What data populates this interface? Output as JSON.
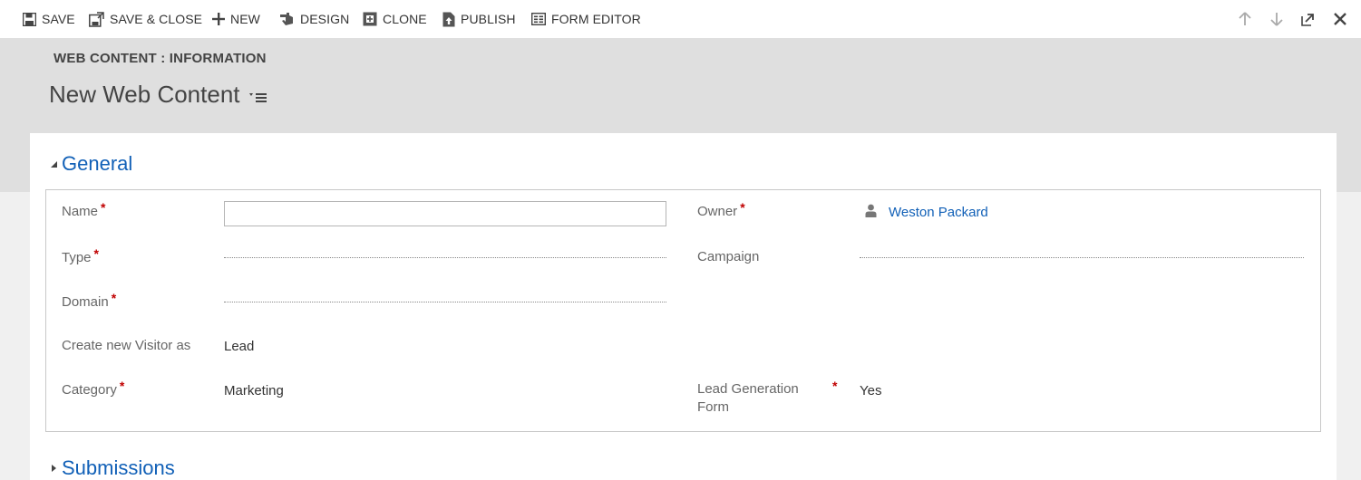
{
  "toolbar": {
    "save": "SAVE",
    "save_close": "SAVE & CLOSE",
    "new": "NEW",
    "design": "DESIGN",
    "clone": "CLONE",
    "publish": "PUBLISH",
    "form_editor": "FORM EDITOR"
  },
  "header": {
    "entity": "WEB CONTENT : INFORMATION",
    "title": "New Web Content"
  },
  "sections": {
    "general": "General",
    "submissions": "Submissions"
  },
  "fields": {
    "name": {
      "label": "Name",
      "value": ""
    },
    "type": {
      "label": "Type",
      "value": ""
    },
    "domain": {
      "label": "Domain",
      "value": ""
    },
    "create_visitor": {
      "label": "Create new Visitor as",
      "value": "Lead"
    },
    "category": {
      "label": "Category",
      "value": "Marketing"
    },
    "owner": {
      "label": "Owner",
      "value": "Weston Packard"
    },
    "campaign": {
      "label": "Campaign",
      "value": ""
    },
    "lead_gen_form": {
      "label_line1": "Lead Generation",
      "label_line2": "Form",
      "value": "Yes"
    }
  },
  "required_marker": "*",
  "colors": {
    "accent": "#1160b7",
    "required": "#c00000",
    "header_band": "#dfdfdf"
  },
  "icons": {
    "save": "floppy-disk-icon",
    "save_close": "save-close-icon",
    "new": "plus-icon",
    "design": "design-hand-icon",
    "clone": "clone-icon",
    "publish": "publish-icon",
    "form_editor": "form-editor-icon",
    "up": "arrow-up-icon",
    "down": "arrow-down-icon",
    "popout": "popout-icon",
    "close": "close-icon",
    "owner": "person-icon"
  }
}
